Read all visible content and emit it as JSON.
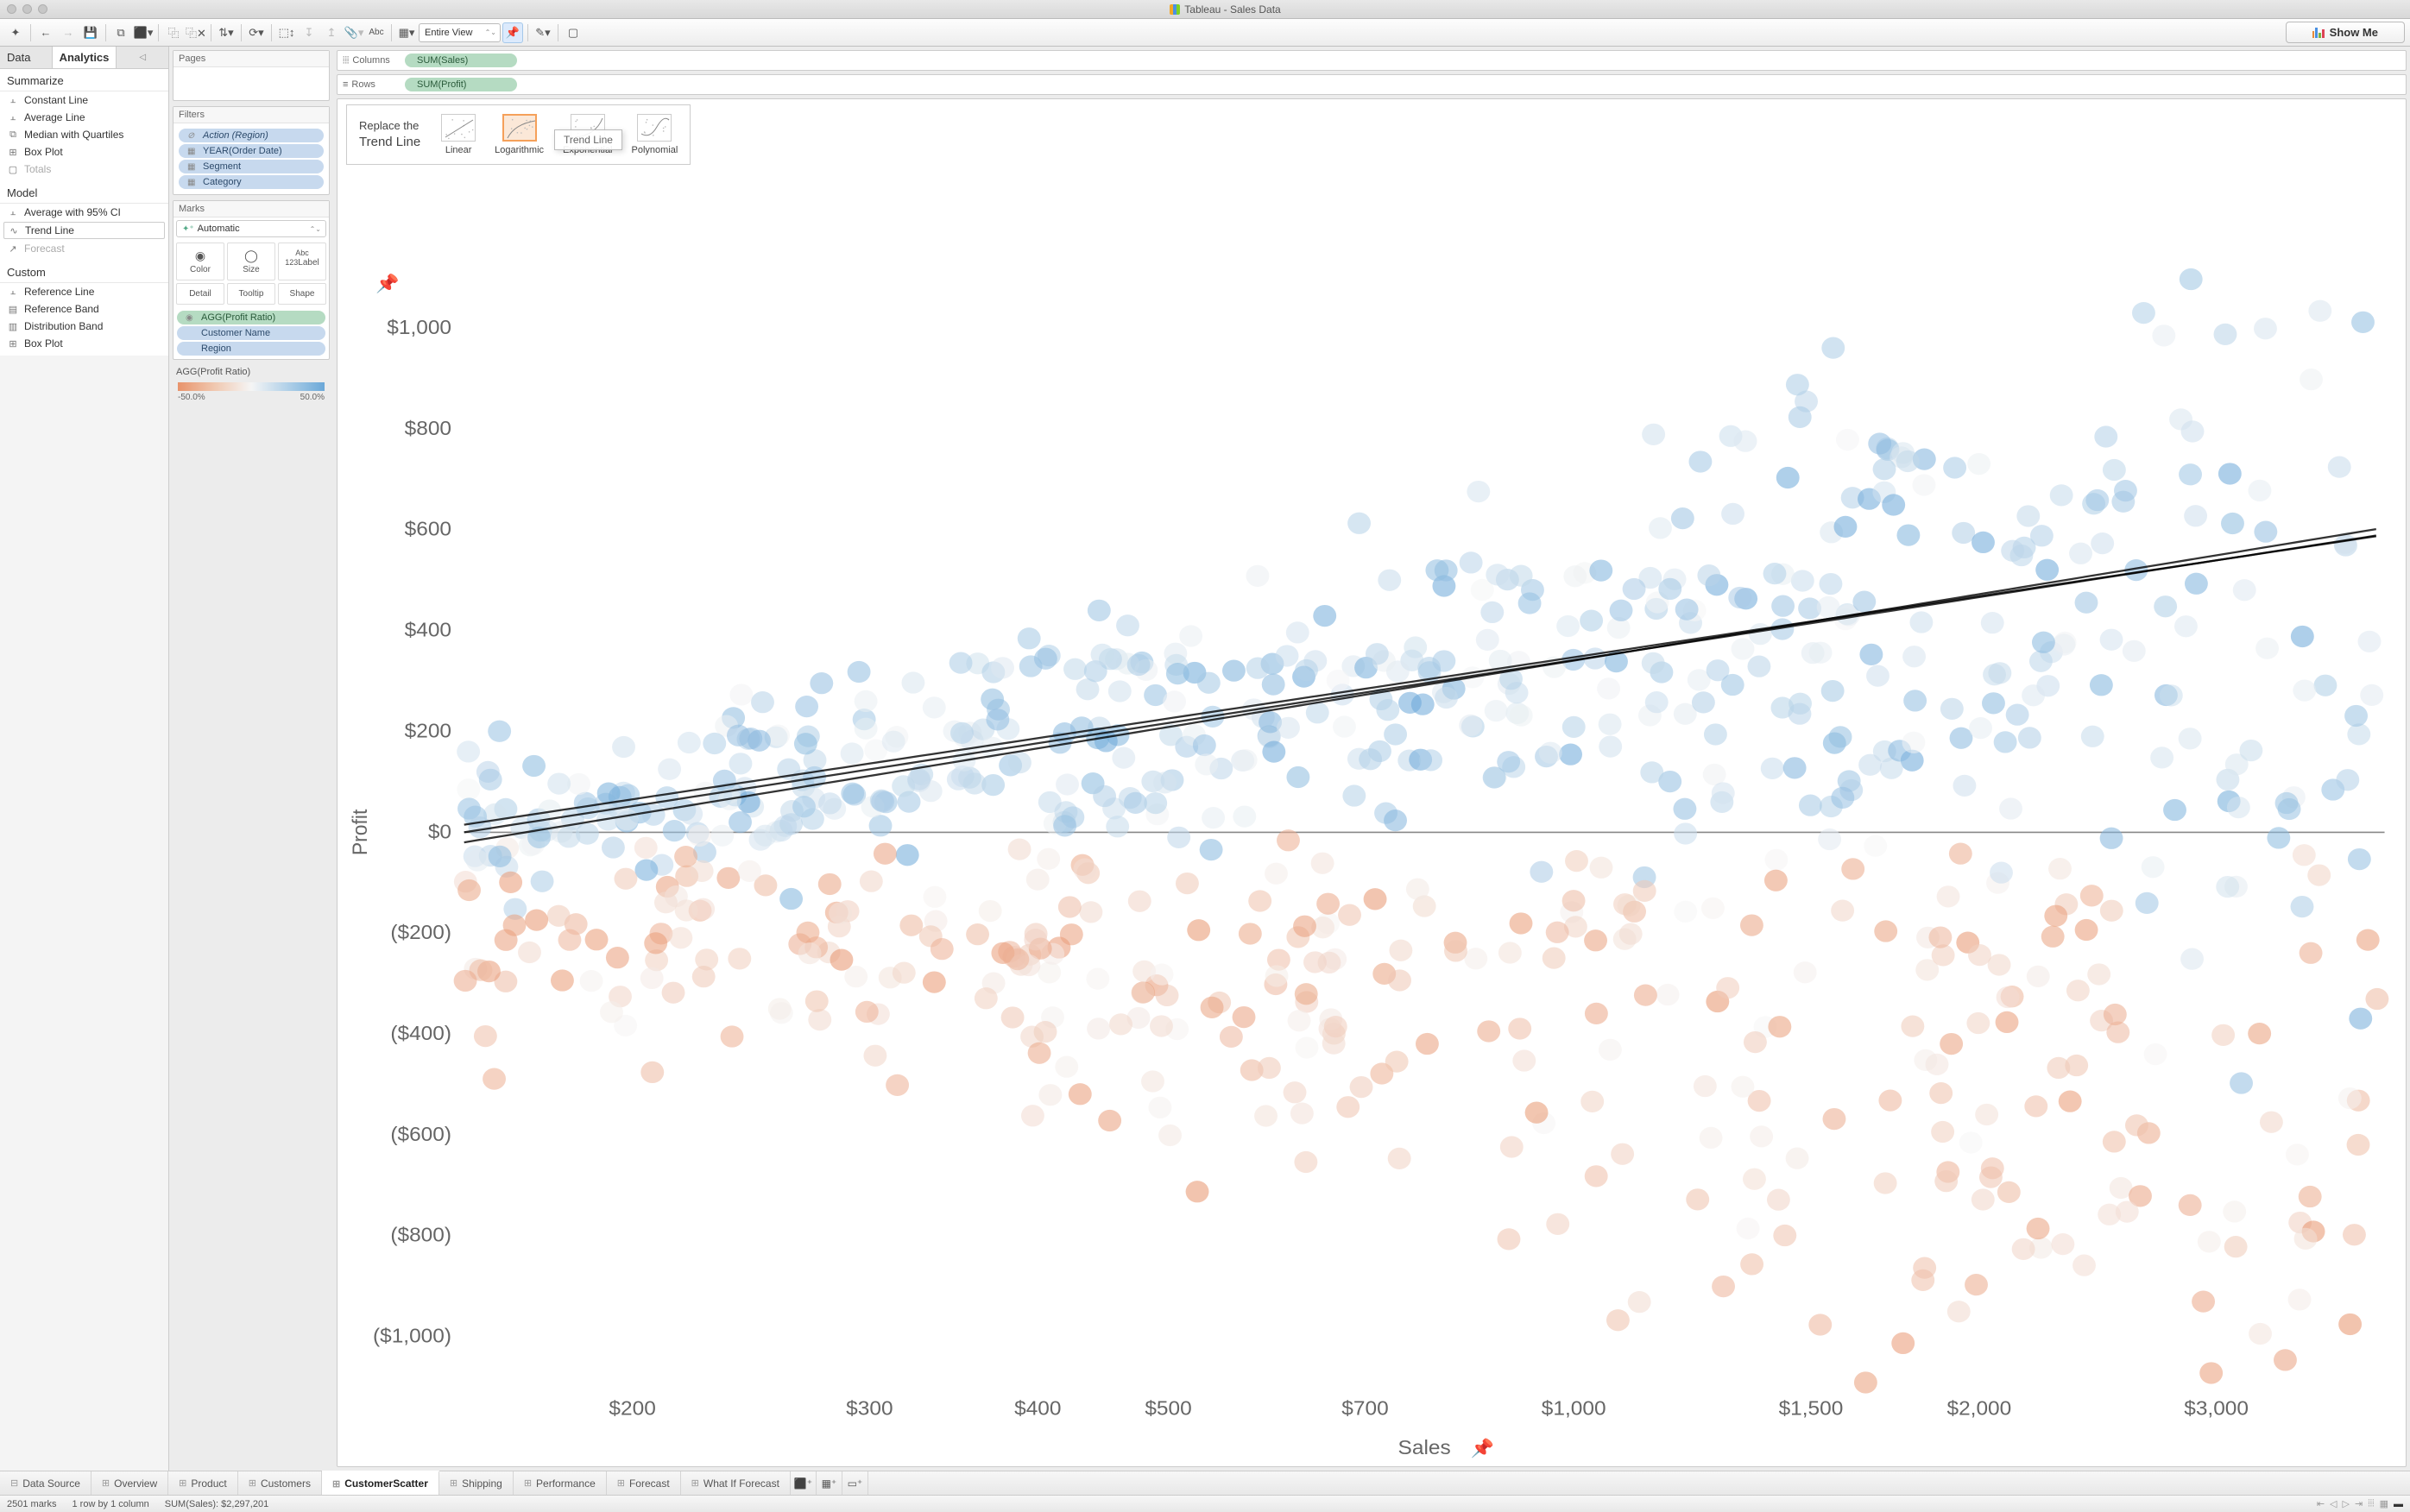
{
  "titlebar": {
    "title": "Tableau - Sales Data"
  },
  "toolbar": {
    "view_mode": "Entire View",
    "showme": "Show Me"
  },
  "side_tabs": {
    "data": "Data",
    "analytics": "Analytics"
  },
  "analytics": {
    "summarize_h": "Summarize",
    "summarize": [
      "Constant Line",
      "Average Line",
      "Median with Quartiles",
      "Box Plot",
      "Totals"
    ],
    "model_h": "Model",
    "model": [
      "Average with 95% CI",
      "Trend Line",
      "Forecast"
    ],
    "custom_h": "Custom",
    "custom": [
      "Reference Line",
      "Reference Band",
      "Distribution Band",
      "Box Plot"
    ]
  },
  "cards": {
    "pages_h": "Pages",
    "filters_h": "Filters",
    "filters": [
      {
        "label": "Action (Region)",
        "italic": true,
        "icon": "⊘"
      },
      {
        "label": "YEAR(Order Date)",
        "icon": "▦"
      },
      {
        "label": "Segment",
        "icon": "▦"
      },
      {
        "label": "Category",
        "icon": "▦"
      }
    ],
    "marks_h": "Marks",
    "marks_type": "Automatic",
    "mark_cells": [
      {
        "icon": "◉",
        "label": "Color"
      },
      {
        "icon": "◯",
        "label": "Size"
      },
      {
        "icon": "Abc",
        "sub": "123",
        "label": "Label"
      },
      {
        "icon": "",
        "label": "Detail"
      },
      {
        "icon": "",
        "label": "Tooltip"
      },
      {
        "icon": "",
        "label": "Shape"
      }
    ],
    "mark_pills": [
      {
        "label": "AGG(Profit Ratio)",
        "cls": "pill-green",
        "icon": "◉"
      },
      {
        "label": "Customer Name",
        "cls": "pill-blue",
        "icon": ""
      },
      {
        "label": "Region",
        "cls": "pill-blue",
        "icon": ""
      }
    ],
    "legend_h": "AGG(Profit Ratio)",
    "legend_min": "-50.0%",
    "legend_max": "50.0%"
  },
  "shelves": {
    "columns_l": "Columns",
    "columns_v": "SUM(Sales)",
    "rows_l": "Rows",
    "rows_v": "SUM(Profit)"
  },
  "trend_panel": {
    "line1": "Replace the",
    "line2": "Trend Line",
    "opts": [
      "Linear",
      "Logarithmic",
      "Exponential",
      "Polynomial"
    ],
    "ghost": "Trend Line"
  },
  "bottom_tabs": {
    "ds": "Data Source",
    "tabs": [
      "Overview",
      "Product",
      "Customers",
      "CustomerScatter",
      "Shipping",
      "Performance",
      "Forecast",
      "What If Forecast"
    ],
    "active": "CustomerScatter"
  },
  "status": {
    "marks": "2501 marks",
    "layout": "1 row by 1 column",
    "sum": "SUM(Sales): $2,297,201"
  },
  "chart_data": {
    "type": "scatter",
    "title": "",
    "xlabel": "Sales",
    "ylabel": "Profit",
    "x_scale": "log",
    "xlim": [
      150,
      4000
    ],
    "ylim": [
      -1100,
      1100
    ],
    "x_ticks": [
      "$200",
      "$300",
      "$400",
      "$500",
      "$700",
      "$1,000",
      "$1,500",
      "$2,000",
      "$3,000"
    ],
    "y_ticks": [
      "$1,000",
      "$800",
      "$600",
      "$400",
      "$200",
      "$0",
      "($200)",
      "($400)",
      "($600)",
      "($800)",
      "($1,000)"
    ],
    "color_field": "AGG(Profit Ratio)",
    "color_range": [
      -0.5,
      0.5
    ],
    "color_scale": [
      "#e8936b",
      "#f5f5f5",
      "#6ba8d8"
    ],
    "n_points": 2501,
    "trend_model": "logarithmic",
    "trend_curves": [
      {
        "a": 0,
        "b": 180
      },
      {
        "a": -20,
        "b": 190
      },
      {
        "a": 15,
        "b": 175
      }
    ],
    "description": "Each point is a customer; x = SUM(Sales) on a log axis from ~$150 to ~$4000; y = SUM(Profit) from ~-$1100 to ~$1100; color diverging orange→blue by Profit Ratio. Three overlaid black logarithmic trend lines (one per Region selection) rise from ~$50–$100 profit at low sales to ~$500–$600 at $3000+."
  }
}
